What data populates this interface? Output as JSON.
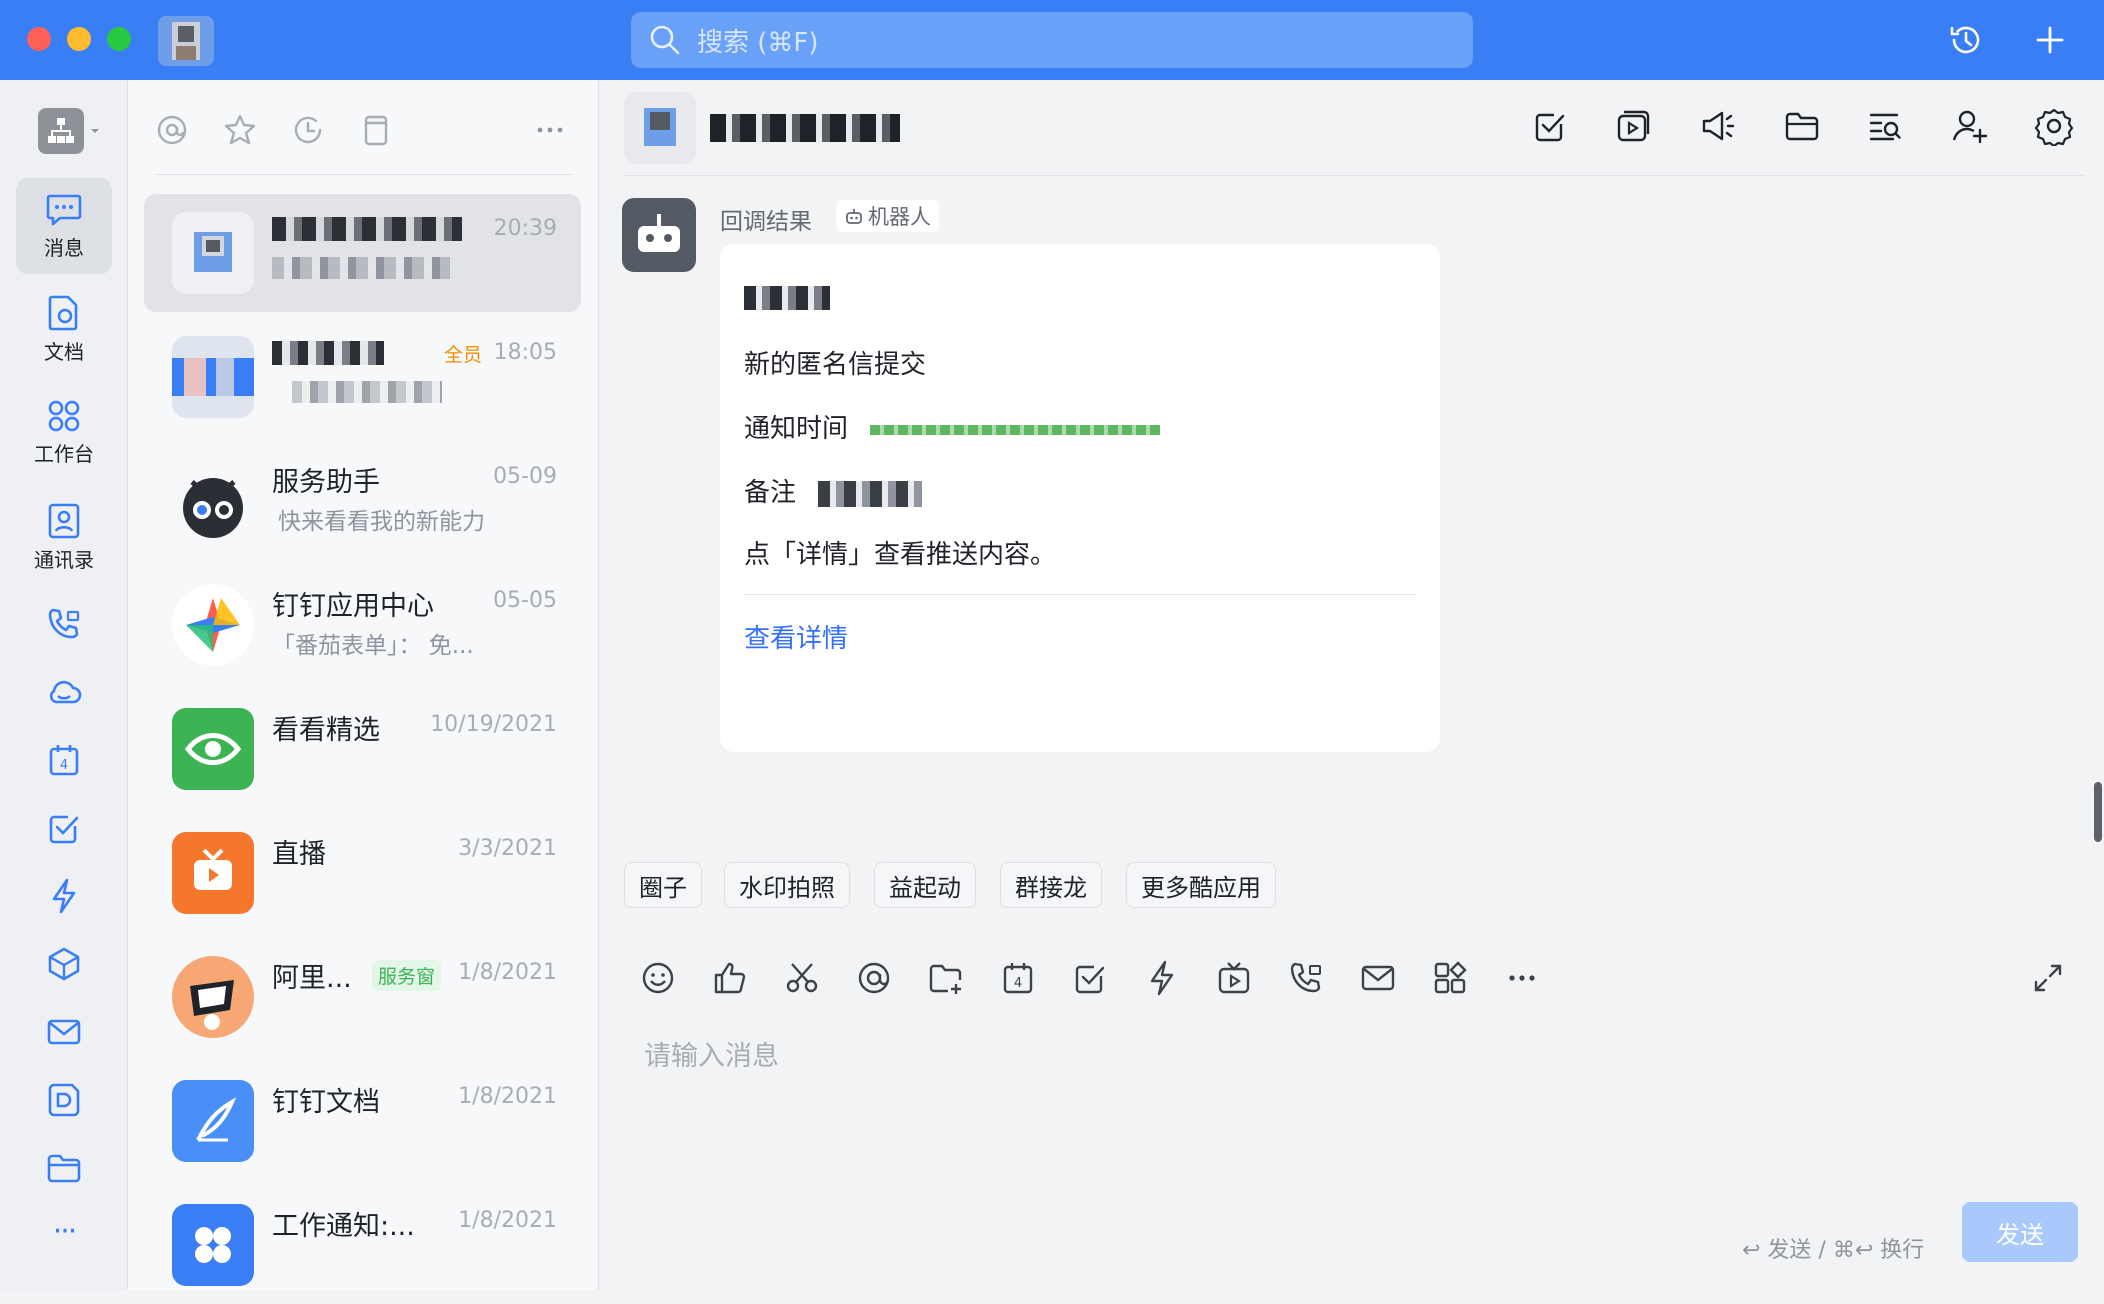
{
  "window": {
    "search_placeholder": "搜索 (⌘F)"
  },
  "sidebar": {
    "items": [
      {
        "label": "消息",
        "icon": "message-icon"
      },
      {
        "label": "文档",
        "icon": "document-icon"
      },
      {
        "label": "工作台",
        "icon": "workbench-icon"
      },
      {
        "label": "通讯录",
        "icon": "contacts-icon"
      }
    ],
    "more": "···"
  },
  "conversations": [
    {
      "name": "",
      "message": "",
      "time": "20:39",
      "badge": ""
    },
    {
      "name": "",
      "message": "",
      "time": "18:05",
      "badge": "全员"
    },
    {
      "name": "服务助手",
      "message": "快来看看我的新能力",
      "time": "05-09",
      "badge": ""
    },
    {
      "name": "钉钉应用中心",
      "message": "「番茄表单」： 免...",
      "time": "05-05",
      "badge": ""
    },
    {
      "name": "看看精选",
      "message": "",
      "time": "10/19/2021",
      "badge": ""
    },
    {
      "name": "直播",
      "message": "",
      "time": "3/3/2021",
      "badge": ""
    },
    {
      "name": "阿里...",
      "message": "",
      "time": "1/8/2021",
      "badge": "服务窗"
    },
    {
      "name": "钉钉文档",
      "message": "",
      "time": "1/8/2021",
      "badge": ""
    },
    {
      "name": "工作通知:...",
      "message": "",
      "time": "1/8/2021",
      "badge": ""
    }
  ],
  "chat": {
    "sender": "回调结果",
    "sender_tag": "机器人",
    "card": {
      "line1": "新的匿名信提交",
      "notify_label": "通知时间",
      "remark_label": "备注",
      "hint": "点「详情」查看推送内容。",
      "link": "查看详情"
    },
    "chips": [
      "圈子",
      "水印拍照",
      "益起动",
      "群接龙",
      "更多酷应用"
    ],
    "input_placeholder": "请输入消息",
    "send_hint": "↩ 发送 / ⌘↩ 换行",
    "send_label": "发送"
  },
  "colors": {
    "brand": "#3a7ef6",
    "link": "#3370ff",
    "notify_bar": "#5db761"
  }
}
